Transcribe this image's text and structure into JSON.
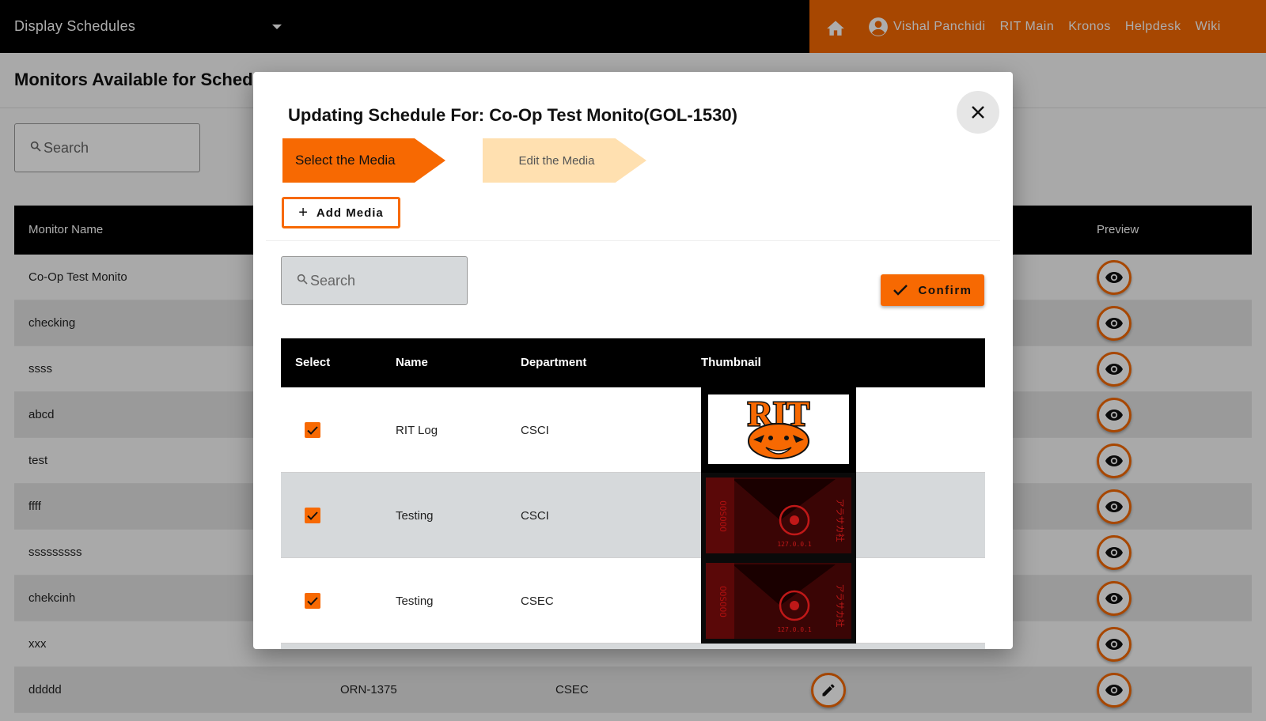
{
  "topbar": {
    "app_select": "Display Schedules",
    "nav": {
      "user": "Vishal Panchidi",
      "links": [
        "RIT Main",
        "Kronos",
        "Helpdesk",
        "Wiki"
      ]
    }
  },
  "page": {
    "title": "Monitors Available for Scheduling",
    "search_placeholder": "Search",
    "table": {
      "headers": {
        "monitor_name": "Monitor Name",
        "preview": "Preview"
      },
      "rows": [
        {
          "name": "Co-Op Test Monito",
          "id": "",
          "dept": ""
        },
        {
          "name": "checking",
          "id": "",
          "dept": ""
        },
        {
          "name": "ssss",
          "id": "",
          "dept": ""
        },
        {
          "name": "abcd",
          "id": "",
          "dept": ""
        },
        {
          "name": "test",
          "id": "",
          "dept": ""
        },
        {
          "name": "ffff",
          "id": "",
          "dept": ""
        },
        {
          "name": "sssssssss",
          "id": "",
          "dept": ""
        },
        {
          "name": "chekcinh",
          "id": "",
          "dept": ""
        },
        {
          "name": "xxx",
          "id": "",
          "dept": ""
        },
        {
          "name": "ddddd",
          "id": "ORN-1375",
          "dept": "CSEC"
        }
      ]
    }
  },
  "dialog": {
    "title": "Updating Schedule For: Co-Op Test Monito(GOL-1530)",
    "steps": [
      "Select the Media",
      "Edit the Media"
    ],
    "add_media": "Add Media",
    "search_placeholder": "Search",
    "confirm": "Confirm",
    "table": {
      "headers": [
        "Select",
        "Name",
        "Department",
        "Thumbnail"
      ],
      "rows": [
        {
          "checked": true,
          "name": "RIT Log",
          "dept": "CSCI",
          "thumbnail": "rit-tiger-logo"
        },
        {
          "checked": true,
          "name": "Testing",
          "dept": "CSCI",
          "thumbnail": "red-poster"
        },
        {
          "checked": true,
          "name": "Testing",
          "dept": "CSEC",
          "thumbnail": "red-poster"
        }
      ]
    },
    "thumb_text": {
      "rit": "RIT",
      "poster_code": "127.0.0.1",
      "poster_side": "OOSOOO",
      "poster_jp": "アラサカ社"
    }
  },
  "colors": {
    "accent": "#f76902",
    "accent_light": "#ffe0b0",
    "header_bg": "#000000"
  },
  "icons": {
    "home": "home-icon",
    "user": "account-circle-icon",
    "close": "close-icon",
    "check": "check-icon",
    "search": "search-icon",
    "preview": "eye-icon",
    "edit": "pencil-icon"
  }
}
